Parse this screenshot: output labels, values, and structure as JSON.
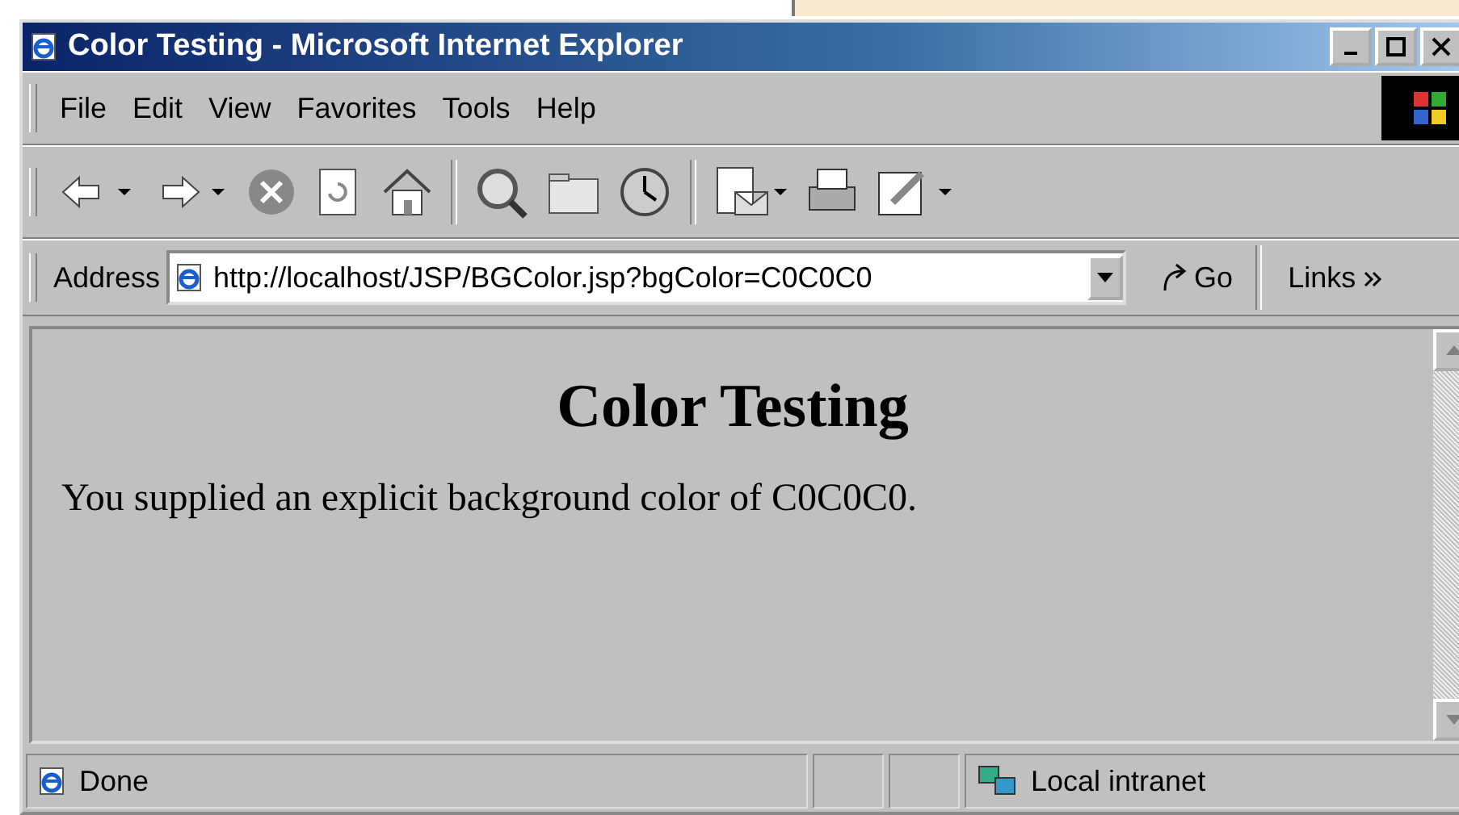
{
  "window": {
    "title": "Color Testing - Microsoft Internet Explorer"
  },
  "menu": [
    "File",
    "Edit",
    "View",
    "Favorites",
    "Tools",
    "Help"
  ],
  "address": {
    "label": "Address",
    "value": "http://localhost/JSP/BGColor.jsp?bgColor=C0C0C0",
    "go": "Go",
    "links": "Links"
  },
  "page": {
    "heading": "Color Testing",
    "text": "You supplied an explicit background color of C0C0C0."
  },
  "status_bar": {
    "text": "Done",
    "zone": "Local intranet"
  }
}
